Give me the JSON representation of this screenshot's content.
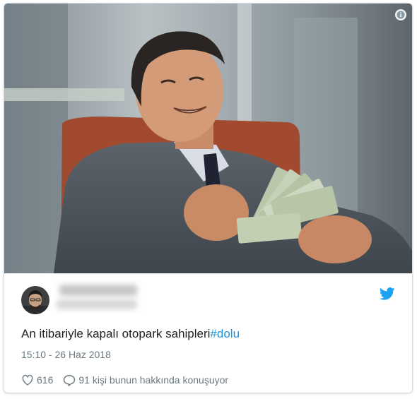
{
  "tweet": {
    "text": "An itibariyle kapalı otopark sahipleri",
    "hashtag": "#dolu",
    "timestamp": "15:10 - 26 Haz 2018"
  },
  "actions": {
    "likes_count": "616",
    "conversation_label": "91 kişi bunun hakkında konuşuyor"
  },
  "icons": {
    "info": "info-icon",
    "twitter": "twitter-bird-icon",
    "heart": "heart-icon",
    "reply": "speech-bubble-icon"
  },
  "colors": {
    "link": "#1b95e0",
    "meta": "#697882",
    "text": "#1c2022"
  }
}
